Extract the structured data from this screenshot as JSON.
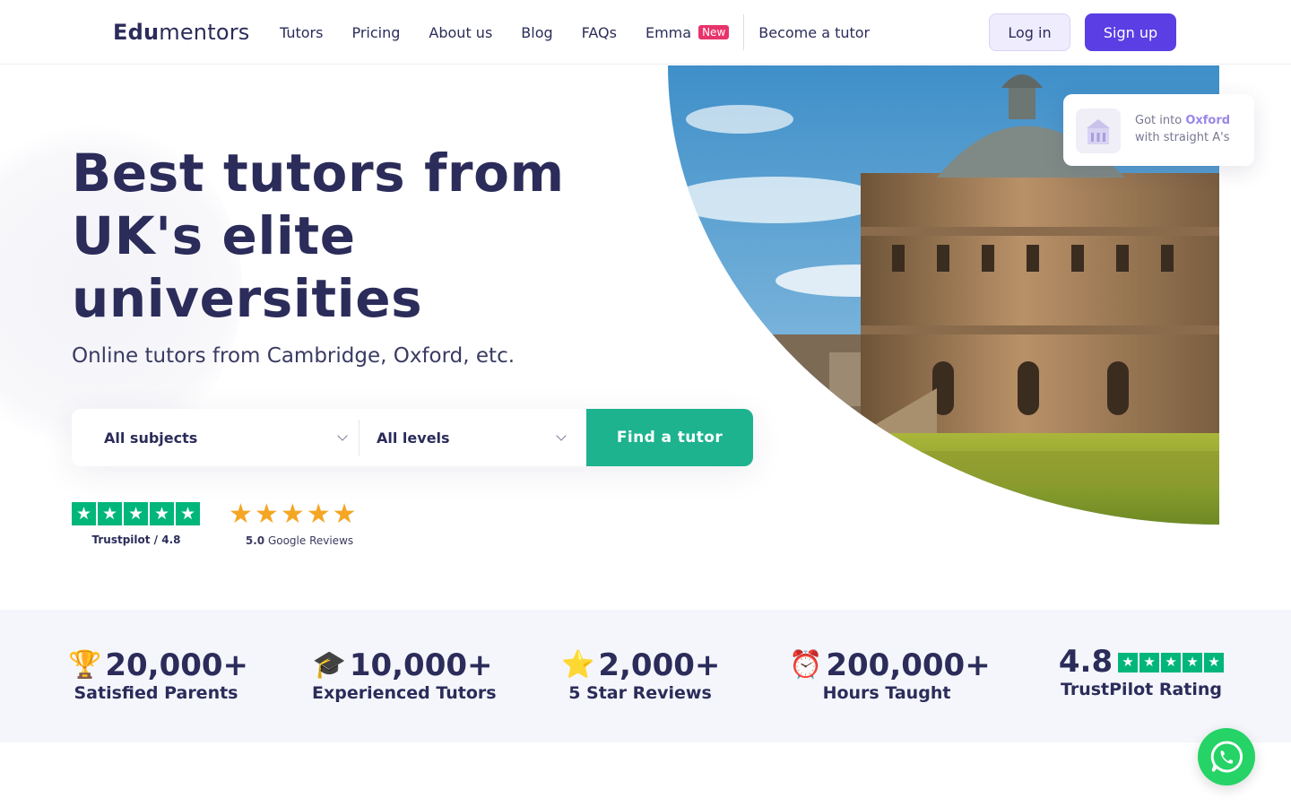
{
  "nav": {
    "logo_bold": "Edu",
    "logo_thin": "mentors",
    "links": [
      "Tutors",
      "Pricing",
      "About us",
      "Blog",
      "FAQs",
      "Emma"
    ],
    "emma_badge": "New",
    "become_tutor": "Become a tutor",
    "login": "Log in",
    "signup": "Sign up"
  },
  "hero": {
    "title_line1": "Best tutors from",
    "title_line2": "UK's elite",
    "title_line3": "universities",
    "subtitle": "Online tutors from Cambridge, Oxford, etc.",
    "search": {
      "subjects": "All subjects",
      "levels": "All levels",
      "button": "Find a tutor"
    },
    "trustpilot_label": "Trustpilot / 4.8",
    "google_score": "5.0",
    "google_label": "Google Reviews",
    "card": {
      "line1_prefix": "Got into",
      "line1_highlight": "Oxford",
      "line2": "with straight A's"
    }
  },
  "stats": [
    {
      "emoji": "🏆",
      "value": "20,000+",
      "label": "Satisfied Parents"
    },
    {
      "emoji": "🎓",
      "value": "10,000+",
      "label": "Experienced Tutors"
    },
    {
      "emoji": "⭐",
      "value": "2,000+",
      "label": "5 Star Reviews"
    },
    {
      "emoji": "⏰",
      "value": "200,000+",
      "label": "Hours Taught"
    },
    {
      "emoji": "",
      "value": "4.8",
      "label": "TrustPilot Rating"
    }
  ],
  "colors": {
    "primary": "#5b3ee4",
    "accent_green": "#1eb38f",
    "trustpilot_green": "#00b67a",
    "badge_pink": "#e8336b",
    "text_dark": "#2b2c5a",
    "whatsapp": "#25d366"
  },
  "icons": {
    "whatsapp": "whatsapp-icon",
    "chevron": "chevron-down-icon",
    "star": "star-icon"
  }
}
